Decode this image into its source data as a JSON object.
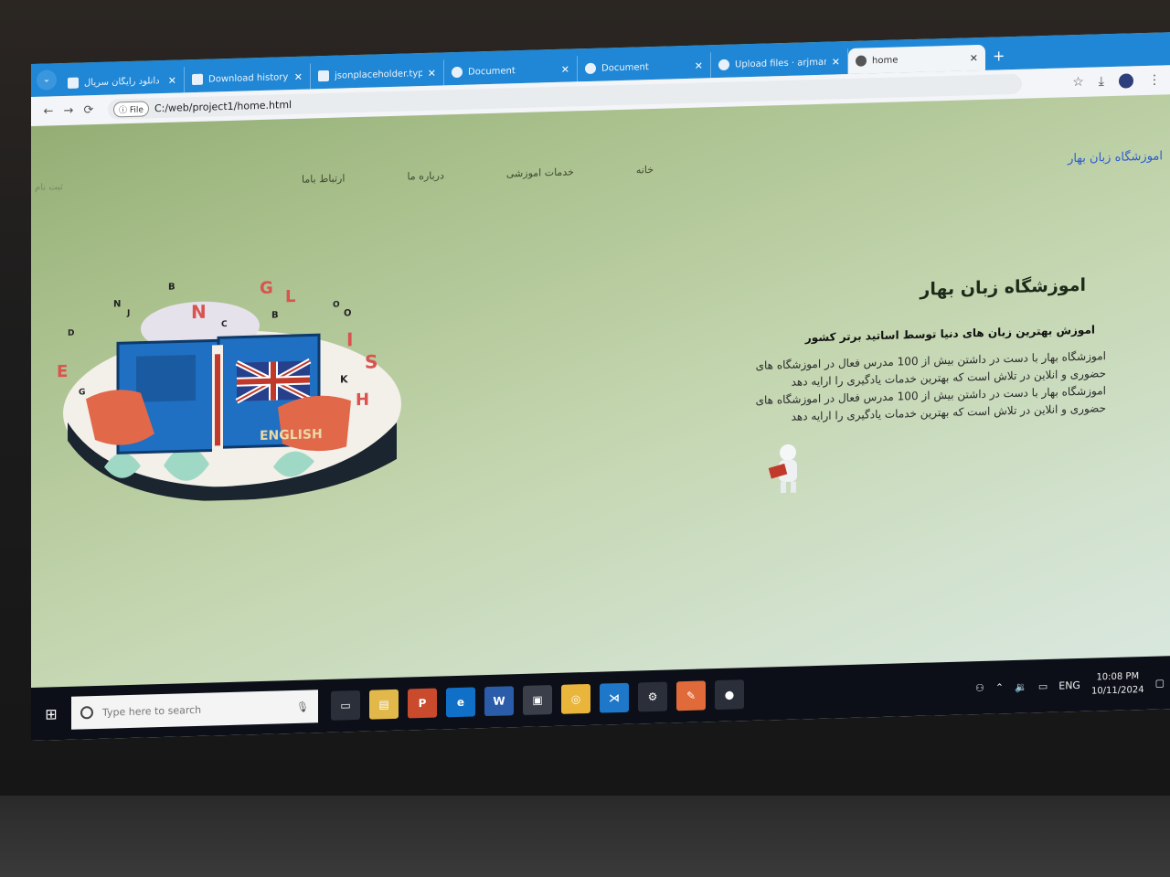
{
  "browser": {
    "tabs": [
      {
        "title": "دانلود رایگان سریال ...",
        "icon": "page-icon",
        "active": false
      },
      {
        "title": "Download history",
        "icon": "download-icon",
        "active": false
      },
      {
        "title": "jsonplaceholder.typic",
        "icon": "page-icon",
        "active": false
      },
      {
        "title": "Document",
        "icon": "globe-icon",
        "active": false
      },
      {
        "title": "Document",
        "icon": "globe-icon",
        "active": false
      },
      {
        "title": "Upload files · arjman",
        "icon": "github-icon",
        "active": false
      },
      {
        "title": "home",
        "icon": "globe-icon",
        "active": true
      }
    ],
    "new_tab": "+",
    "scheme_label": "File",
    "url": "C:/web/project1/home.html"
  },
  "site": {
    "brand": "اموزشگاه زبان بهار",
    "menu": [
      "خانه",
      "خدمات اموزشی",
      "درباره ما",
      "ارتباط باما"
    ],
    "register": "ثبت نام",
    "hero": {
      "title": "اموزشگاه زبان بهار",
      "subtitle": "اموزش بهترین زبان های دنیا توسط اساتید برتر کشور",
      "para_lines": [
        "اموزشگاه بهار با دست در داشتن بیش از 100 مدرس فعال در اموزشگاه های",
        "حضوری و انلاین در تلاش است که بهترین خدمات یادگیری را ارایه دهد",
        "اموزشگاه بهار با دست در داشتن بیش از 100 مدرس فعال در اموزشگاه های",
        "حضوری و انلاین در تلاش است که بهترین خدمات یادگیری را ارایه دهد"
      ]
    },
    "illustration": {
      "book_label": "ENGLISH",
      "letters": [
        "N",
        "J",
        "B",
        "G",
        "L",
        "N",
        "C",
        "B",
        "O",
        "O",
        "D",
        "I",
        "S",
        "E",
        "K",
        "H",
        "G"
      ]
    }
  },
  "taskbar": {
    "search_placeholder": "Type here to search",
    "apps": [
      "file-explorer",
      "powerpoint",
      "edge",
      "word",
      "store",
      "chrome",
      "vscode",
      "settings",
      "paint",
      "app"
    ],
    "language": "ENG",
    "time": "10:08 PM",
    "date": "10/11/2024"
  },
  "colors": {
    "tabstrip": "#1f87d6",
    "brand_text": "#2d5bd0",
    "page_bg_start": "#8ea86e",
    "page_bg_end": "#dbe9e2"
  }
}
